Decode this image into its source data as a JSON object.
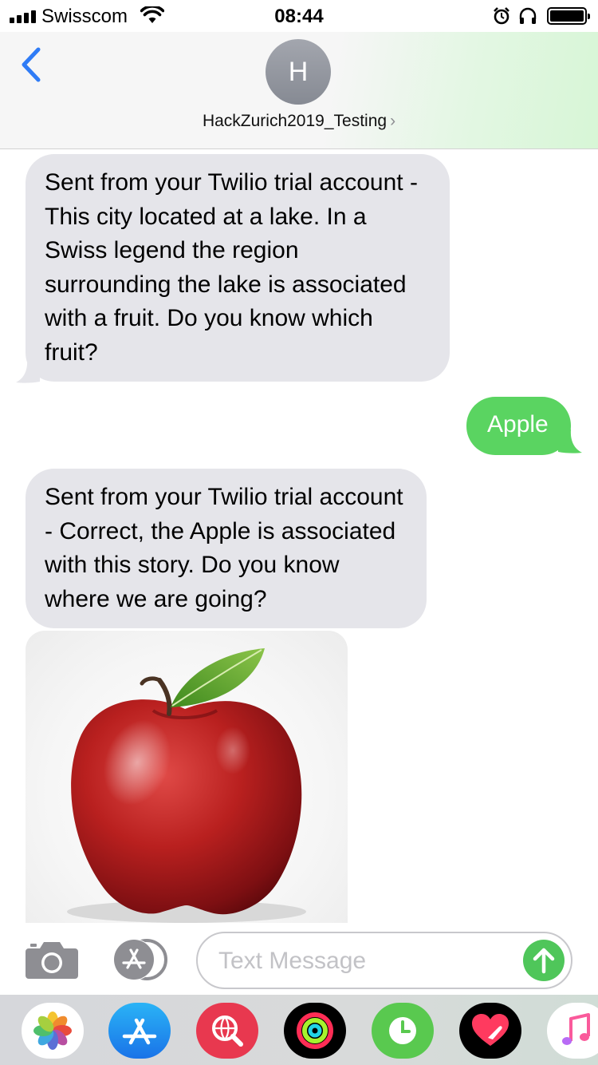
{
  "status_bar": {
    "carrier": "Swisscom",
    "time": "08:44",
    "icons": [
      "signal-icon",
      "wifi-icon",
      "alarm-icon",
      "headphones-icon",
      "battery-icon"
    ]
  },
  "header": {
    "avatar_initial": "H",
    "contact_name": "HackZurich2019_Testing",
    "chevron": "›"
  },
  "messages": [
    {
      "direction": "received",
      "type": "text",
      "text": "Sent from your Twilio trial account - This city located at a lake. In a Swiss legend the region surrounding the lake is associated with a fruit. Do you know which fruit?"
    },
    {
      "direction": "sent",
      "type": "text",
      "text": "Apple"
    },
    {
      "direction": "received",
      "type": "text",
      "text": "Sent from your Twilio trial account - Correct, the Apple is associated with this story. Do you know where we are going?"
    },
    {
      "direction": "received",
      "type": "image",
      "subject": "red-apple"
    }
  ],
  "input": {
    "placeholder": "Text Message"
  },
  "app_drawer": [
    "photos",
    "app-store",
    "web-search",
    "activity",
    "clock",
    "digital-touch",
    "music"
  ],
  "colors": {
    "ios_blue": "#2f7cf6",
    "sent_bubble": "#5ad461",
    "received_bubble": "#e5e5ea",
    "avatar": "#8e9199",
    "placeholder": "#c2c2c6"
  }
}
